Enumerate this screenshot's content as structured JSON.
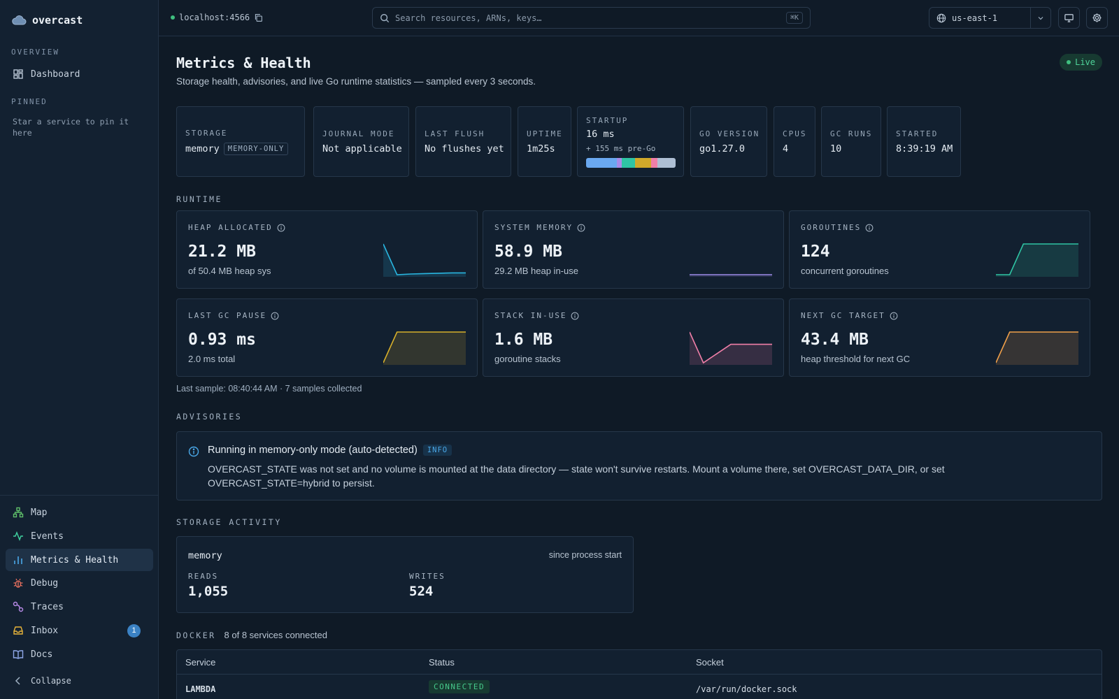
{
  "app": {
    "name": "overcast"
  },
  "sidebar": {
    "overview_label": "OVERVIEW",
    "dashboard": "Dashboard",
    "pinned_label": "PINNED",
    "pinned_hint": "Star a service to pin it here",
    "items": [
      {
        "label": "Map",
        "icon": "map-icon",
        "color": "#5fbf6a"
      },
      {
        "label": "Events",
        "icon": "activity-icon",
        "color": "#3fcf9f"
      },
      {
        "label": "Metrics & Health",
        "icon": "bar-chart-icon",
        "color": "#4aa8e8"
      },
      {
        "label": "Debug",
        "icon": "bug-icon",
        "color": "#e8705f"
      },
      {
        "label": "Traces",
        "icon": "trace-icon",
        "color": "#b88ae8"
      },
      {
        "label": "Inbox",
        "icon": "inbox-icon",
        "color": "#e8b43a",
        "badge": "1"
      },
      {
        "label": "Docs",
        "icon": "book-icon",
        "color": "#8fa8e8"
      }
    ],
    "collapse": "Collapse"
  },
  "topbar": {
    "endpoint": "localhost:4566",
    "search_placeholder": "Search resources, ARNs, keys…",
    "search_shortcut": "⌘K",
    "region": "us-east-1"
  },
  "page": {
    "title": "Metrics & Health",
    "subtitle": "Storage health, advisories, and live Go runtime statistics — sampled every 3 seconds.",
    "live": "Live"
  },
  "stats": {
    "storage": {
      "label": "STORAGE",
      "value": "memory",
      "tag": "MEMORY-ONLY"
    },
    "journal": {
      "label": "JOURNAL MODE",
      "value": "Not applicable"
    },
    "flush": {
      "label": "LAST FLUSH",
      "value": "No flushes yet"
    },
    "uptime": {
      "label": "UPTIME",
      "value": "1m25s"
    },
    "startup": {
      "label": "STARTUP",
      "value": "16 ms",
      "sub": "+ 155 ms pre-Go",
      "segments": [
        {
          "fraction": 0.34,
          "color": "#6aa8f0"
        },
        {
          "fraction": 0.06,
          "color": "#a98be8"
        },
        {
          "fraction": 0.15,
          "color": "#2fc4a4"
        },
        {
          "fraction": 0.18,
          "color": "#d0a82a"
        },
        {
          "fraction": 0.07,
          "color": "#f07fa8"
        },
        {
          "fraction": 0.2,
          "color": "#aebfd4"
        }
      ]
    },
    "go_version": {
      "label": "GO VERSION",
      "value": "go1.27.0"
    },
    "cpus": {
      "label": "CPUS",
      "value": "4"
    },
    "gc_runs": {
      "label": "GC RUNS",
      "value": "10"
    },
    "started": {
      "label": "STARTED",
      "value": "8:39:19 AM"
    }
  },
  "runtime": {
    "label": "RUNTIME",
    "cards": [
      {
        "label": "HEAP ALLOCATED",
        "value": "21.2 MB",
        "sub": "of 50.4 MB heap sys",
        "color": "#29b6e0",
        "spark": [
          95,
          10,
          12,
          13,
          14,
          15,
          15
        ]
      },
      {
        "label": "SYSTEM MEMORY",
        "value": "58.9 MB",
        "sub": "29.2 MB heap in-use",
        "color": "#9d8be8",
        "spark": [
          58.9,
          58.9,
          58.9,
          58.9,
          58.9,
          58.9,
          58.9
        ]
      },
      {
        "label": "GOROUTINES",
        "value": "124",
        "sub": "concurrent goroutines",
        "color": "#2fc4a4",
        "spark": [
          0,
          0,
          124,
          124,
          124,
          124,
          124
        ]
      },
      {
        "label": "LAST GC PAUSE",
        "value": "0.93 ms",
        "sub": "2.0 ms total",
        "color": "#d8b02a",
        "spark": [
          0,
          0.93,
          0.93,
          0.93,
          0.93,
          0.93,
          0.93
        ]
      },
      {
        "label": "STACK IN-USE",
        "value": "1.6 MB",
        "sub": "goroutine stacks",
        "color": "#f07fa8",
        "spark": [
          2.0,
          1.0,
          1.3,
          1.6,
          1.6,
          1.6,
          1.6
        ]
      },
      {
        "label": "NEXT GC TARGET",
        "value": "43.4 MB",
        "sub": "heap threshold for next GC",
        "color": "#f0a04a",
        "spark": [
          0,
          43.4,
          43.4,
          43.4,
          43.4,
          43.4,
          43.4
        ]
      }
    ],
    "last_sample": "Last sample: 08:40:44 AM · 7 samples collected"
  },
  "advisories": {
    "label": "ADVISORIES",
    "items": [
      {
        "title": "Running in memory-only mode (auto-detected)",
        "level": "INFO",
        "body": "OVERCAST_STATE was not set and no volume is mounted at the data directory — state won't survive restarts. Mount a volume there, set OVERCAST_DATA_DIR, or set OVERCAST_STATE=hybrid to persist."
      }
    ]
  },
  "storage_activity": {
    "label": "STORAGE ACTIVITY",
    "engine": "memory",
    "since": "since process start",
    "reads_label": "READS",
    "reads": "1,055",
    "writes_label": "WRITES",
    "writes": "524"
  },
  "docker": {
    "label": "DOCKER",
    "count": "8 of 8 services connected",
    "columns": [
      "Service",
      "Status",
      "Socket"
    ],
    "rows": [
      {
        "service": "LAMBDA",
        "status": "CONNECTED",
        "socket": "/var/run/docker.sock"
      }
    ]
  }
}
